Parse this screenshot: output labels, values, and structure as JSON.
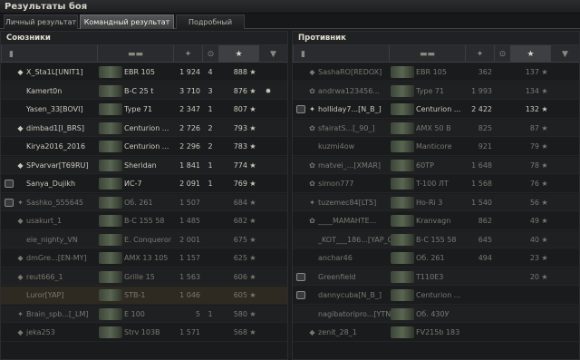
{
  "window_title": "Результаты боя",
  "tabs": [
    {
      "label": "Личный результат",
      "active": false
    },
    {
      "label": "Командный результат",
      "active": true
    },
    {
      "label": "Подробный отчёт",
      "active": false
    }
  ],
  "allies": {
    "title": "Союзники",
    "players": [
      {
        "name": "X_Sta1L[UNIT1]",
        "tank": "EBR 105",
        "damage": "1 924",
        "kills": "4",
        "xp": "888",
        "badge": "diamond",
        "platoon": false,
        "medal": "",
        "dead": false,
        "me": false
      },
      {
        "name": "Kamert0n",
        "tank": "B-C 25 t",
        "damage": "3 710",
        "kills": "3",
        "xp": "876",
        "badge": "",
        "platoon": false,
        "medal": "✹",
        "dead": false,
        "me": false
      },
      {
        "name": "Yasen_33[BOVI]",
        "tank": "Type 71",
        "damage": "2 347",
        "kills": "1",
        "xp": "807",
        "badge": "",
        "platoon": false,
        "medal": "",
        "dead": false,
        "me": false
      },
      {
        "name": "dimbad1[I_BRS]",
        "tank": "Centurion ...",
        "damage": "2 726",
        "kills": "2",
        "xp": "793",
        "badge": "diamond",
        "platoon": false,
        "medal": "",
        "dead": false,
        "me": false
      },
      {
        "name": "Kirya2016_2016",
        "tank": "Centurion ...",
        "damage": "2 296",
        "kills": "2",
        "xp": "783",
        "badge": "",
        "platoon": false,
        "medal": "",
        "dead": false,
        "me": false
      },
      {
        "name": "SPvarvar[T69RU]",
        "tank": "Sheridan",
        "damage": "1 841",
        "kills": "1",
        "xp": "774",
        "badge": "red",
        "platoon": false,
        "medal": "",
        "dead": false,
        "me": false
      },
      {
        "name": "Sanya_Dujikh",
        "tank": "ИС-7",
        "damage": "2 091",
        "kills": "1",
        "xp": "769",
        "badge": "",
        "platoon": true,
        "medal": "",
        "dead": false,
        "me": false
      },
      {
        "name": "Sashko_555645",
        "tank": "Об. 261",
        "damage": "1 507",
        "kills": "",
        "xp": "684",
        "badge": "gold",
        "platoon": true,
        "medal": "",
        "dead": true,
        "me": false
      },
      {
        "name": "usakurt_1",
        "tank": "B-C 155 58",
        "damage": "1 485",
        "kills": "",
        "xp": "682",
        "badge": "diamond",
        "platoon": false,
        "medal": "",
        "dead": true,
        "me": false
      },
      {
        "name": "ele_nighty_VN",
        "tank": "E. Conqueror",
        "damage": "2 001",
        "kills": "",
        "xp": "675",
        "badge": "",
        "platoon": false,
        "medal": "",
        "dead": true,
        "me": false
      },
      {
        "name": "dmGre...[EN-MY]",
        "tank": "AMX 13 105",
        "damage": "1 157",
        "kills": "",
        "xp": "625",
        "badge": "red",
        "platoon": false,
        "medal": "",
        "dead": true,
        "me": false
      },
      {
        "name": "reut666_1",
        "tank": "Grille 15",
        "damage": "1 563",
        "kills": "",
        "xp": "606",
        "badge": "diamond",
        "platoon": false,
        "medal": "",
        "dead": true,
        "me": false
      },
      {
        "name": "Luror[YAP]",
        "tank": "STB-1",
        "damage": "1 046",
        "kills": "",
        "xp": "605",
        "badge": "",
        "platoon": false,
        "medal": "",
        "dead": true,
        "me": true
      },
      {
        "name": "Brain_spb...[_LM]",
        "tank": "E 100",
        "damage": "5",
        "kills": "1",
        "xp": "580",
        "badge": "gold",
        "platoon": false,
        "medal": "",
        "dead": true,
        "me": false
      },
      {
        "name": "jeka253",
        "tank": "Strv 103B",
        "damage": "1 571",
        "kills": "",
        "xp": "568",
        "badge": "diamond",
        "platoon": false,
        "medal": "",
        "dead": true,
        "me": false
      }
    ]
  },
  "enemies": {
    "title": "Противник",
    "players": [
      {
        "name": "SashaRO[REDOX]",
        "tank": "EBR 105",
        "damage": "362",
        "kills": "",
        "xp": "137",
        "badge": "red",
        "platoon": false,
        "dead": true
      },
      {
        "name": "andrwa123456...",
        "tank": "Type 71",
        "damage": "1 993",
        "kills": "",
        "xp": "134",
        "badge": "pink",
        "platoon": false,
        "dead": true
      },
      {
        "name": "holliday7...[N_B_]",
        "tank": "Centurion ...",
        "damage": "2 422",
        "kills": "",
        "xp": "132",
        "badge": "gold",
        "platoon": true,
        "dead": false
      },
      {
        "name": "sfairatS...[_90_]",
        "tank": "AMX 50 B",
        "damage": "825",
        "kills": "",
        "xp": "87",
        "badge": "pink",
        "platoon": false,
        "dead": true
      },
      {
        "name": "kuzmi4ow",
        "tank": "Manticore",
        "damage": "921",
        "kills": "",
        "xp": "79",
        "badge": "",
        "platoon": false,
        "dead": true
      },
      {
        "name": "matvei_...[XMAR]",
        "tank": "60TP",
        "damage": "1 648",
        "kills": "",
        "xp": "78",
        "badge": "pink",
        "platoon": false,
        "dead": true
      },
      {
        "name": "simon777",
        "tank": "T-100 ЛТ",
        "damage": "1 568",
        "kills": "",
        "xp": "76",
        "badge": "pink",
        "platoon": false,
        "dead": true
      },
      {
        "name": "tuzemec84[LT5]",
        "tank": "Ho-Ri 3",
        "damage": "1 540",
        "kills": "",
        "xp": "56",
        "badge": "gold",
        "platoon": false,
        "dead": true
      },
      {
        "name": "____МАМАНТЕ...",
        "tank": "Kranvagn",
        "damage": "862",
        "kills": "",
        "xp": "49",
        "badge": "pink",
        "platoon": false,
        "dead": true
      },
      {
        "name": "_KOT___186...[YAP_C]",
        "tank": "B-C 155 58",
        "damage": "645",
        "kills": "",
        "xp": "40",
        "badge": "",
        "platoon": false,
        "dead": true
      },
      {
        "name": "anchar46",
        "tank": "Об. 261",
        "damage": "494",
        "kills": "",
        "xp": "23",
        "badge": "",
        "platoon": false,
        "dead": true
      },
      {
        "name": "Greenfield",
        "tank": "T110E3",
        "damage": "",
        "kills": "",
        "xp": "20",
        "badge": "",
        "platoon": true,
        "dead": true
      },
      {
        "name": "dannycuba[N_B_]",
        "tank": "Centurion ...",
        "damage": "",
        "kills": "",
        "xp": "",
        "badge": "",
        "platoon": true,
        "dead": true
      },
      {
        "name": "nagibatoripro...[YTNK]",
        "tank": "Об. 430У",
        "damage": "",
        "kills": "",
        "xp": "",
        "badge": "",
        "platoon": false,
        "dead": true
      },
      {
        "name": "zenit_28_1",
        "tank": "FV215b 183",
        "damage": "",
        "kills": "",
        "xp": "",
        "badge": "diamond",
        "platoon": false,
        "dead": true
      }
    ]
  }
}
